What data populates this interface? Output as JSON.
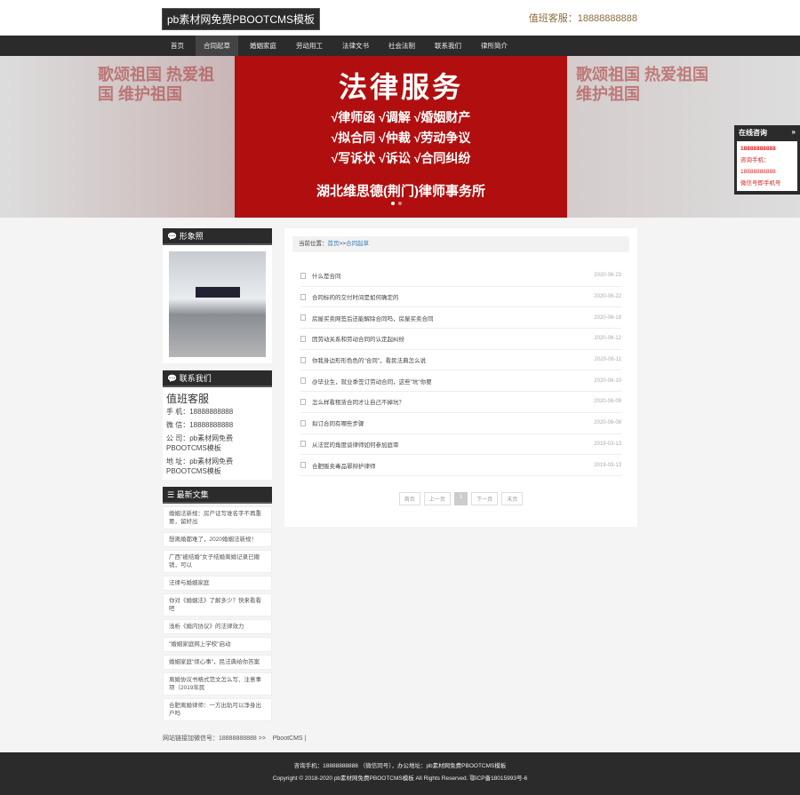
{
  "header": {
    "logo": "pb素材网免费PBOOTCMS模板",
    "hotline": "值班客服：18888888888"
  },
  "nav": [
    "首页",
    "合同起草",
    "婚姻家庭",
    "劳动用工",
    "法律文书",
    "社会法制",
    "联系我们",
    "律所简介"
  ],
  "banner": {
    "title": "法律服务",
    "services": [
      "√律师函 √调解 √婚姻财产",
      "√拟合同 √仲裁 √劳动争议",
      "√写诉状 √诉讼 √合同纠纷"
    ],
    "firm": "湖北维思德(荆门)律师事务所",
    "side_text": "歌颂祖国 热爱祖国 维护祖国"
  },
  "consult": {
    "title": "在线咨询",
    "arrow": "»",
    "lines": [
      "18888888888",
      "咨询手机：",
      "18888888888",
      "微信号即手机号"
    ]
  },
  "sidebar": {
    "photo_title": "形象照",
    "contact_title": "联系我们",
    "duty": "值班客服",
    "contact": [
      "手 机：18888888888",
      "微 信：18888888888",
      "公 司：pb素材网免费PBOOTCMS模板",
      "地 址：pb素材网免费PBOOTCMS模板"
    ],
    "news_title": "最新文集",
    "news": [
      "婚姻法新规：房产证写谁名字不再重要，留好出",
      "想离婚都难了，2020婚姻法新规！",
      "广西\"被结婚\"女子结婚离婚记录已撤销，可以",
      "法律与婚姻家庭",
      "你对《婚姻法》了解多少？快来看看吧",
      "浅析《婚内协议》的法律效力",
      "\"婚姻家庭网上学校\"启动",
      "婚姻家庭\"烦心事\"，民法典给你答案",
      "离婚协议书格式范文怎么写、注意事项（2019年民",
      "合肥离婚律师：一方出轨可以净身出户吗"
    ]
  },
  "links": {
    "label": "网站链接加微信号：18888888888 >>",
    "item": "PbootCMS |"
  },
  "main": {
    "crumb_label": "当前位置：",
    "crumb_home": "首页",
    "crumb_sep": ">>",
    "crumb_current": "合同起草",
    "articles": [
      {
        "title": "什么是合同",
        "date": "2020-06-23"
      },
      {
        "title": "合同标的的交付时间是如何确定的",
        "date": "2020-06-22"
      },
      {
        "title": "房屋买卖网签后还能解除合同吗，房屋买卖合同",
        "date": "2020-06-19"
      },
      {
        "title": "因劳动关系和劳动合同的认定起纠纷",
        "date": "2020-06-12"
      },
      {
        "title": "你我身边形形色色的\"合同\"，看民法典怎么说",
        "date": "2020-06-11"
      },
      {
        "title": "@毕业生，就业季签订劳动合同，这些\"坑\"你要",
        "date": "2020-06-10"
      },
      {
        "title": "怎么样看租赁合同才让自己不掉坑？",
        "date": "2020-06-09"
      },
      {
        "title": "拟订合同有哪些步骤",
        "date": "2020-06-08"
      },
      {
        "title": "从法官的角度谈律师如何参加庭审",
        "date": "2019-03-13"
      },
      {
        "title": "合肥贩卖毒品罪辩护律师",
        "date": "2019-03-13"
      }
    ],
    "pager": [
      "首页",
      "上一页",
      "1",
      "下一页",
      "末页"
    ]
  },
  "footer": {
    "line1": "咨询手机：18888888888 （微信同号），办公地址：pb素材网免费PBOOTCMS模板",
    "line2": "Copyright © 2018-2020 pb素材网免费PBOOTCMS模板 All Rights Reserved.   鄂ICP备18015993号-6"
  }
}
